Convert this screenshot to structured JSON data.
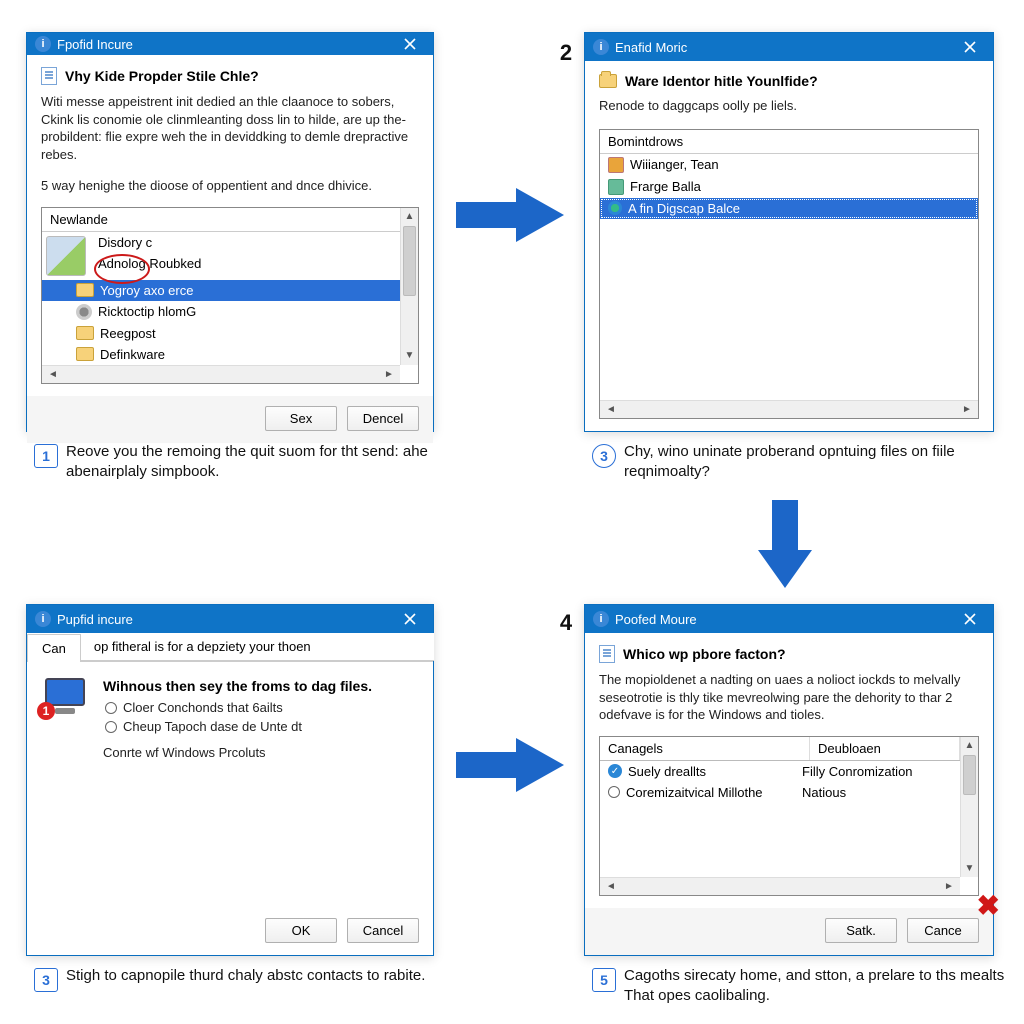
{
  "steps": {
    "top_left_number": "1",
    "top_right_number": "2",
    "mid_left_number": "3",
    "mid_right_number": "4",
    "badge_1": "1",
    "badge_3a": "3",
    "badge_3b": "3",
    "badge_5": "5",
    "caption_1": "Reove you the remoing the quit suom for tht send: ahe abenairplaly simpbook.",
    "caption_3a": "Chy, wino uninate proberand opntuing files on fiile reqnimoalty?",
    "caption_3b": "Stigh to capnopile thurd chaly abstc contacts to rabite.",
    "caption_5": "Cagoths sirecaty home, and stton, a prelare to ths mealts That opes caolibaling."
  },
  "dialog1": {
    "title": "Fpofid Incure",
    "heading": "Vhy Kide Propder Stile Chle?",
    "para1": "Witi messe appeistrent init dedied an thle claanoce to sobers, Ckink lis conomie ole clinmleanting doss lin to hilde, are up the-probildent: flie expre weh the in deviddking to demle drepractive rebes.",
    "para2": "5 way henighe the dioose of oppentient and dnce dhivice.",
    "list_header": "Newlande",
    "items": [
      "Disdory c",
      "Adnolog Roubked",
      "Yogroy axo erce",
      "Ricktoctip hlomG",
      "Reegpost",
      "Definkware"
    ],
    "selected_index": 2,
    "btn_ok": "Sex",
    "btn_cancel": "Dencel"
  },
  "dialog2": {
    "title": "Enafid Moric",
    "heading": "Ware Identor hitle Younlfide?",
    "subtext": "Renode to daggcaps oolly pe liels.",
    "list_header": "Bomintdrows",
    "items": [
      "Wiiianger, Tean",
      "Frarge Balla",
      "A fin Digscap Balce"
    ],
    "selected_index": 2
  },
  "dialog3": {
    "title": "Pupfid incure",
    "tab1": "Can",
    "tab2": "op fitheral is for a depziety your thoen",
    "heading": "Wihnous then sey the froms to dag files.",
    "opt1": "Cloer Conchonds that 6ailts",
    "opt2": "Cheup Tapoch dase de Unte dt",
    "linktext": "Conrte wf Windows Prcoluts",
    "btn_ok": "OK",
    "btn_cancel": "Cancel"
  },
  "dialog4": {
    "title": "Poofed Moure",
    "heading": "Whico wp pbore facton?",
    "para": "The mopioldenet a nadting on uaes a nolioct iockds to melvally seseotrotie is thly tike mevreolwing pare the dehority to thar 2 odefvave is for the Windows and tioles.",
    "col1": "Canagels",
    "col2": "Deubloaen",
    "rows": [
      {
        "c1": "Suely dreallts",
        "c2": "Filly Conromization"
      },
      {
        "c1": "Coremizaitvical Millothe",
        "c2": "Natious"
      }
    ],
    "btn_ok": "Satk.",
    "btn_cancel": "Cance"
  }
}
